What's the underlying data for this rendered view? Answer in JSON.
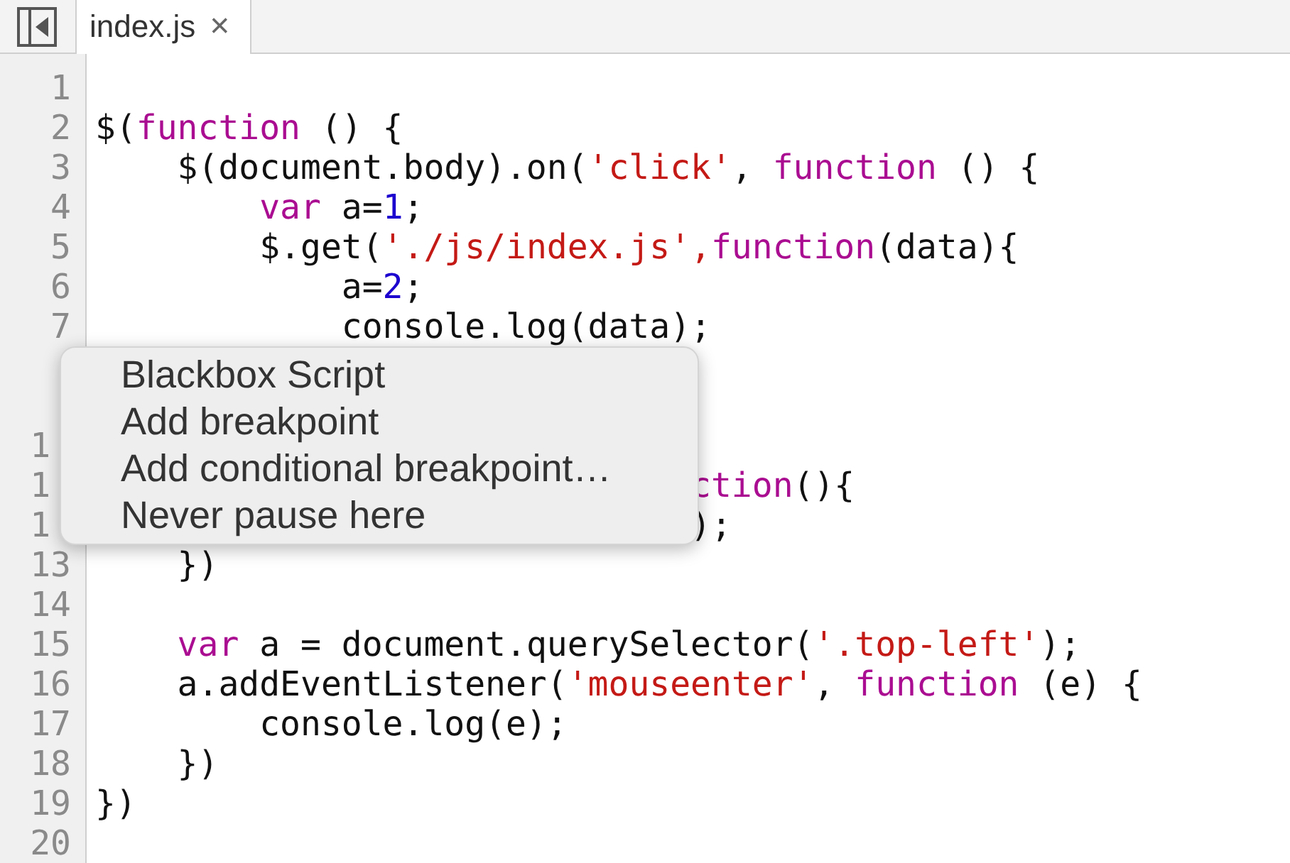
{
  "tabs": [
    {
      "label": "index.js",
      "close": "×",
      "selected": true
    }
  ],
  "lines": [
    {
      "number": "1"
    },
    {
      "number": "2",
      "tokens": [
        {
          "text": "$(",
          "kind": "plain"
        },
        {
          "text": "function",
          "kind": "keyword"
        },
        {
          "text": " () {",
          "kind": "plain"
        }
      ]
    },
    {
      "number": "3",
      "tokens": [
        {
          "text": "    $(document.body).on(",
          "kind": "plain"
        },
        {
          "text": "'click'",
          "kind": "string"
        },
        {
          "text": ", ",
          "kind": "plain"
        },
        {
          "text": "function",
          "kind": "keyword"
        },
        {
          "text": " () {",
          "kind": "plain"
        }
      ]
    },
    {
      "number": "4",
      "tokens": [
        {
          "text": "        var",
          "kind": "keyword"
        },
        {
          "text": " a=",
          "kind": "plain"
        },
        {
          "text": "1",
          "kind": "number"
        },
        {
          "text": ";",
          "kind": "plain"
        }
      ]
    },
    {
      "number": "5",
      "tokens": [
        {
          "text": "        $.get(",
          "kind": "plain"
        },
        {
          "text": "'./js/index.js',",
          "kind": "string"
        },
        {
          "text": "function",
          "kind": "keyword"
        },
        {
          "text": "(data){",
          "kind": "plain"
        }
      ]
    },
    {
      "number": "6",
      "tokens": [
        {
          "text": "            a=",
          "kind": "plain"
        },
        {
          "text": "2",
          "kind": "number"
        },
        {
          "text": ";",
          "kind": "plain"
        }
      ]
    },
    {
      "number": "7",
      "tokens": [
        {
          "text": "            console.log(data);",
          "kind": "plain"
        }
      ]
    },
    {
      "number": "1",
      "number_covered": true
    },
    {
      "number": "1",
      "number_covered": true,
      "tokens": [
        {
          "text": "                             ction",
          "kind": "keyword"
        },
        {
          "text": "(){",
          "kind": "plain"
        }
      ]
    },
    {
      "number": "1",
      "number_covered": true,
      "tokens": [
        {
          "text": "                             );",
          "kind": "plain"
        }
      ]
    },
    {
      "number": "13",
      "tokens": [
        {
          "text": "    })",
          "kind": "plain"
        }
      ]
    },
    {
      "number": "14"
    },
    {
      "number": "15",
      "tokens": [
        {
          "text": "    var",
          "kind": "keyword"
        },
        {
          "text": " a = document.querySelector(",
          "kind": "plain"
        },
        {
          "text": "'.top-left'",
          "kind": "string"
        },
        {
          "text": ");",
          "kind": "plain"
        }
      ]
    },
    {
      "number": "16",
      "tokens": [
        {
          "text": "    a.addEventListener(",
          "kind": "plain"
        },
        {
          "text": "'mouseenter'",
          "kind": "string"
        },
        {
          "text": ", ",
          "kind": "plain"
        },
        {
          "text": "function",
          "kind": "keyword"
        },
        {
          "text": " (e) {",
          "kind": "plain"
        }
      ]
    },
    {
      "number": "17",
      "tokens": [
        {
          "text": "        console.log(e);",
          "kind": "plain"
        }
      ]
    },
    {
      "number": "18",
      "tokens": [
        {
          "text": "    })",
          "kind": "plain"
        }
      ]
    },
    {
      "number": "19",
      "tokens": [
        {
          "text": "})",
          "kind": "plain"
        }
      ]
    },
    {
      "number": "20"
    }
  ],
  "context_menu": {
    "items": [
      "Blackbox Script",
      "Add breakpoint",
      "Add conditional breakpoint…",
      "Never pause here"
    ]
  }
}
